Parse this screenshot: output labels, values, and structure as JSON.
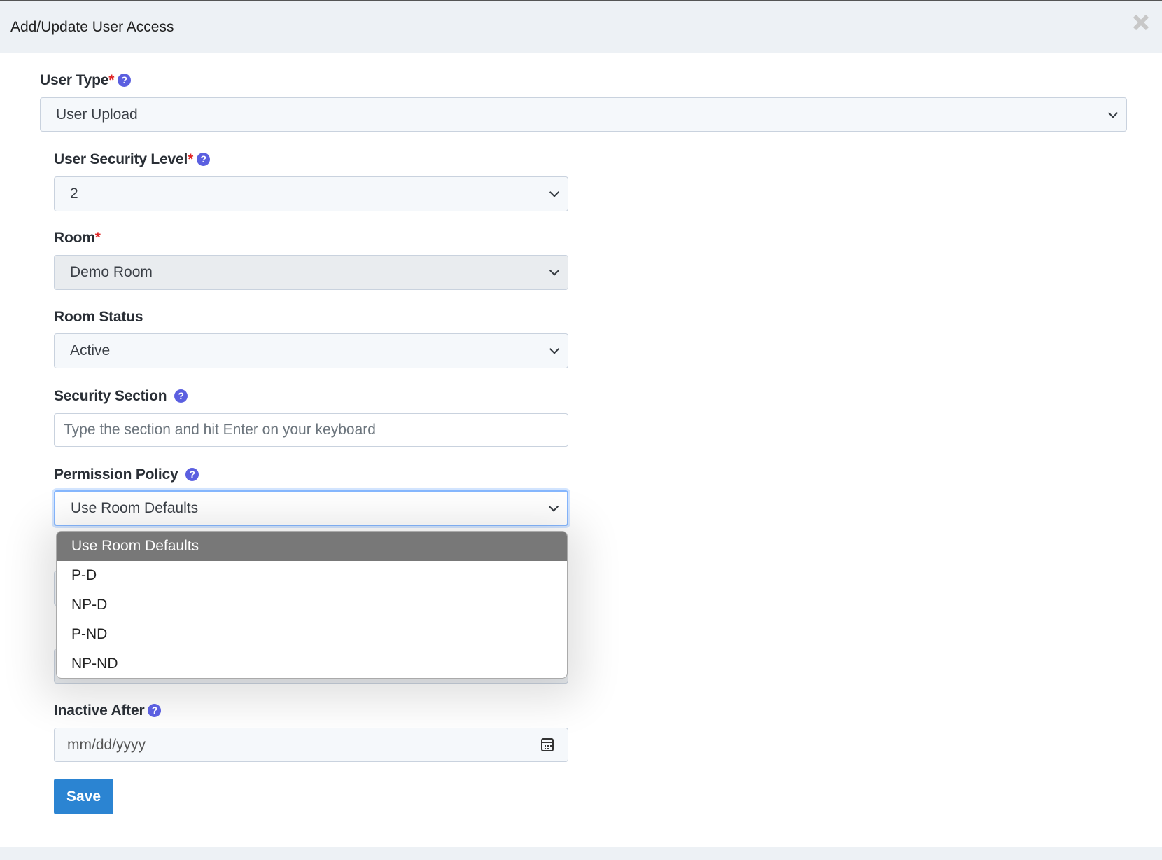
{
  "dialog": {
    "title": "Add/Update User Access",
    "close_icon": "close-icon"
  },
  "fields": {
    "user_type": {
      "label": "User Type",
      "required": "*",
      "value": "User Upload"
    },
    "security_level": {
      "label": "User Security Level",
      "required": "*",
      "value": "2"
    },
    "room": {
      "label": "Room",
      "required": "*",
      "value": "Demo Room"
    },
    "room_status": {
      "label": "Room Status",
      "value": "Active"
    },
    "security_section": {
      "label": "Security Section",
      "placeholder": "Type the section and hit Enter on your keyboard"
    },
    "permission_policy": {
      "label": "Permission Policy",
      "value": "Use Room Defaults",
      "options": [
        "Use Room Defaults",
        "P-D",
        "NP-D",
        "P-ND",
        "NP-ND"
      ]
    },
    "inactive_after": {
      "label": "Inactive After",
      "placeholder": "mm/dd/yyyy"
    }
  },
  "help_glyph": "?",
  "save_label": "Save",
  "colors": {
    "accent": "#2b84d2",
    "help": "#5b5fe0",
    "required": "#e02424",
    "header_bg": "#edf1f5"
  }
}
